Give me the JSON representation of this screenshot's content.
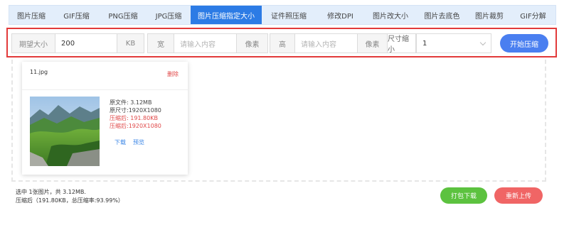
{
  "tabs": [
    {
      "label": "图片压缩"
    },
    {
      "label": "GIF压缩"
    },
    {
      "label": "PNG压缩"
    },
    {
      "label": "JPG压缩"
    },
    {
      "label": "图片压缩指定大小",
      "active": true
    },
    {
      "label": "证件照压缩"
    },
    {
      "label": "修改DPI"
    },
    {
      "label": "图片改大小"
    },
    {
      "label": "图片去底色"
    },
    {
      "label": "图片裁剪"
    },
    {
      "label": "GIF分解"
    }
  ],
  "params": {
    "expected_size_label": "期望大小",
    "expected_size_value": "200",
    "kb_unit": "KB",
    "width_label": "宽",
    "width_placeholder": "请输入内容",
    "width_unit": "像素",
    "height_label": "高",
    "height_placeholder": "请输入内容",
    "height_unit": "像素",
    "scale_label": "尺寸缩小",
    "scale_value": "1",
    "start_button": "开始压缩"
  },
  "card": {
    "filename": "11.jpg",
    "delete_label": "删除",
    "original_file": "原文件: 3.12MB",
    "original_size": "原尺寸:1920X1080",
    "compressed_file": "压缩后: 191.80KB",
    "compressed_size": "压缩后:1920X1080",
    "download_label": "下载",
    "preview_label": "预览"
  },
  "summary": {
    "line1": "选中 1张图片，共 3.12MB.",
    "line2": "压缩后（191.80KB，总压缩率:93.99%）"
  },
  "buttons": {
    "pack_download": "打包下载",
    "reupload": "重新上传"
  },
  "colors": {
    "accent": "#2c7be5",
    "highlight_frame": "#e23a3a",
    "start_button": "#4a7ff0",
    "pack_button": "#5cc23f",
    "reupload_button": "#f06565",
    "compressed_text": "#e04848"
  }
}
